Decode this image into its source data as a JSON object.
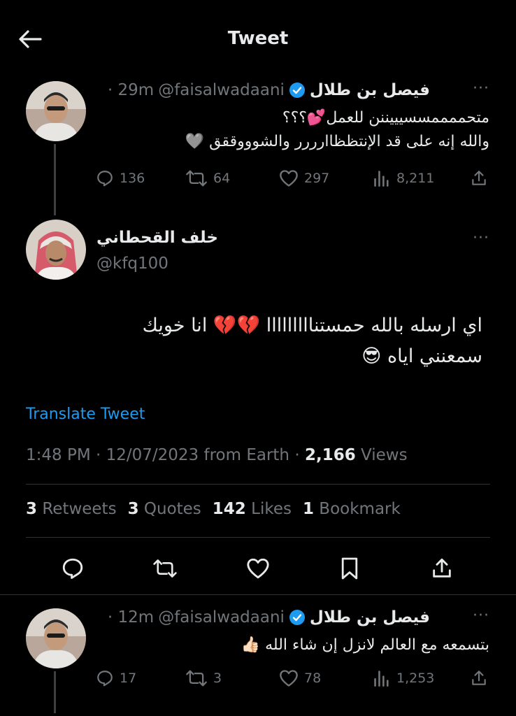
{
  "header": {
    "title": "Tweet"
  },
  "tweet1": {
    "name": "فيصل بن طلال",
    "handle": "@faisalwadaani",
    "time": "· 29m",
    "line1": "متحممممسسيييننن للعمل💕؟؟؟",
    "line2": "والله إنه على قد الإنتظظاارررر والشوووققق 🩶",
    "replies": "136",
    "retweets": "64",
    "likes": "297",
    "views": "8,211"
  },
  "main": {
    "name": "خلف القحطاني",
    "handle": "@kfq100",
    "line1": "اي ارسله بالله حمستنااااااااا 💔💔 انا خويك",
    "line2": "سمعنني اياه 😎",
    "translate": "Translate Tweet",
    "time": "1:48 PM",
    "date": "12/07/2023 from Earth",
    "views_count": "2,166",
    "views_label": "Views",
    "retweets_count": "3",
    "retweets_label": "Retweets",
    "quotes_count": "3",
    "quotes_label": "Quotes",
    "likes_count": "142",
    "likes_label": "Likes",
    "bookmarks_count": "1",
    "bookmarks_label": "Bookmark"
  },
  "tweet2": {
    "name": "فيصل بن طلال",
    "handle": "@faisalwadaani",
    "time": "· 12m",
    "line1": "بتسمعه مع العالم لانزل إن شاء الله 👍🏻",
    "replies": "17",
    "retweets": "3",
    "likes": "78",
    "views": "1,253"
  },
  "icons": {
    "back": "arrow-left-icon",
    "verified": "verified-badge-icon",
    "reply": "reply-icon",
    "retweet": "retweet-icon",
    "like": "heart-icon",
    "views": "views-icon",
    "share": "share-icon",
    "bookmark": "bookmark-icon",
    "more": "more-icon"
  },
  "colors": {
    "accent": "#1d9bf0",
    "muted": "#71767b",
    "text": "#e7e9ea",
    "background": "#000000"
  }
}
